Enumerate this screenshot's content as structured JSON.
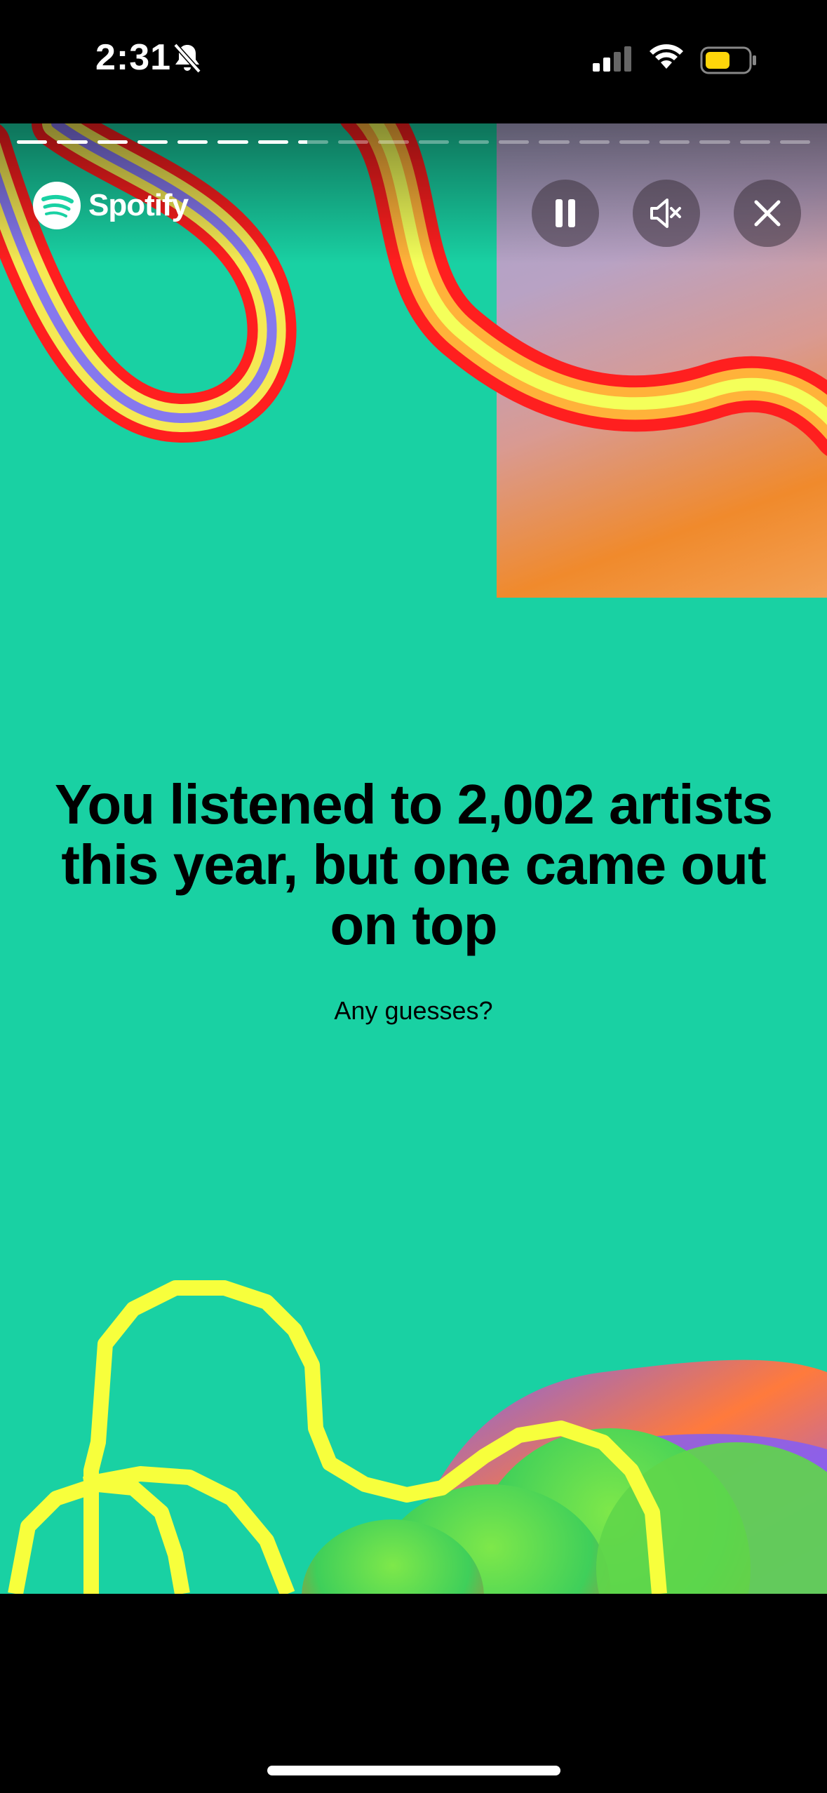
{
  "status_bar": {
    "time": "2:31"
  },
  "story": {
    "progress_total": 20,
    "progress_completed": 7,
    "logo_text": "Spotify",
    "headline": "You listened to 2,002 artists this year, but one came out on top",
    "subheadline": "Any guesses?",
    "background_color": "#19d1a3",
    "accent_yellow": "#f7ff3c"
  },
  "controls": {
    "pause_icon": "pause-icon",
    "mute_icon": "speaker-muted-icon",
    "close_icon": "close-icon"
  }
}
